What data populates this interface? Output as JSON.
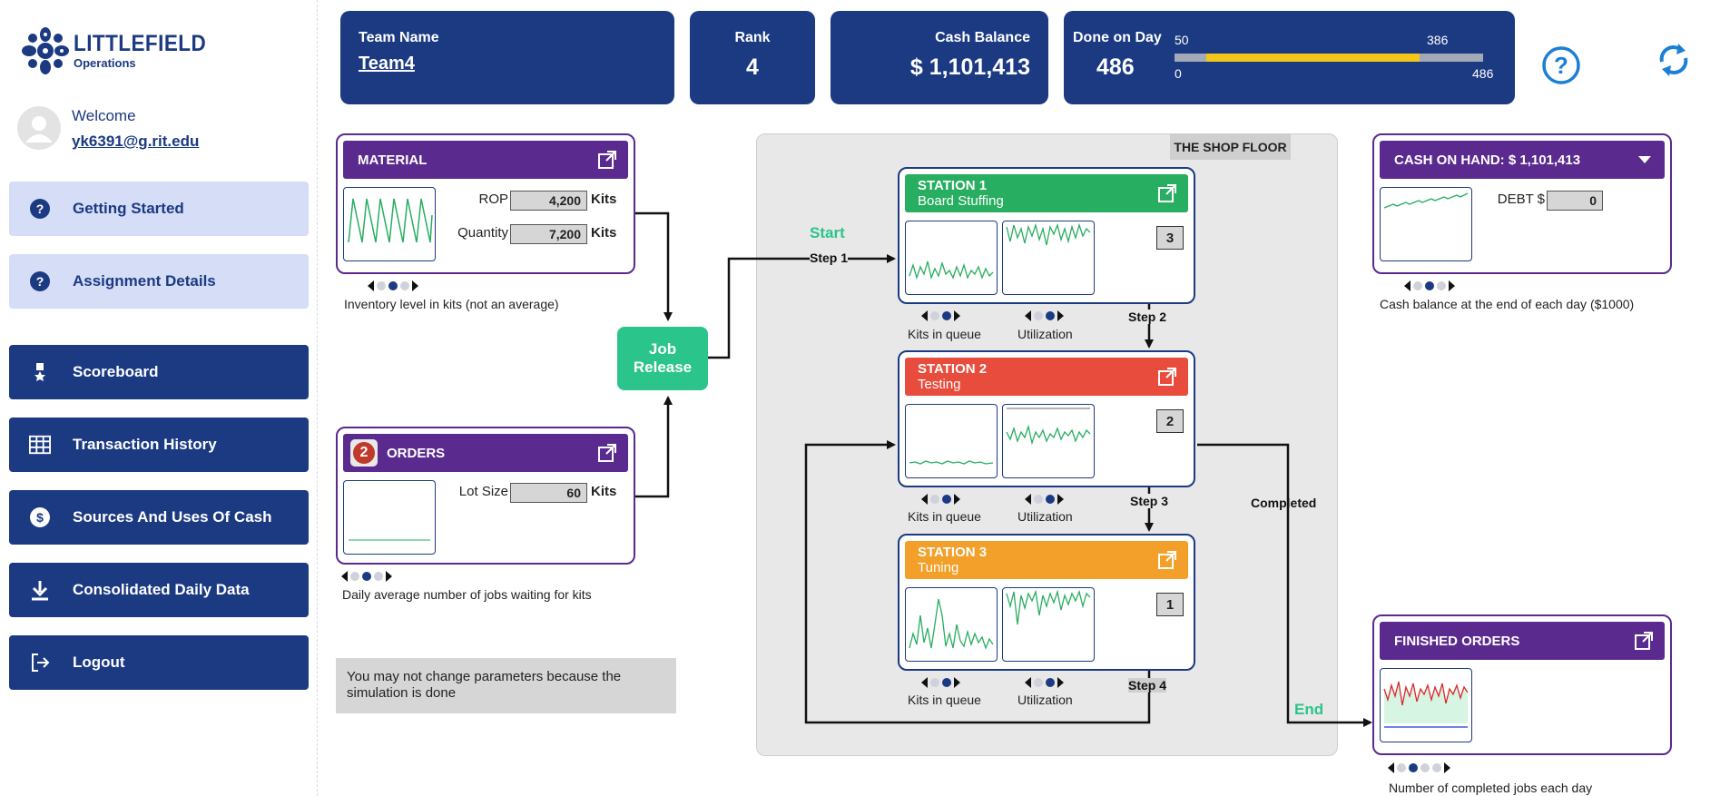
{
  "logo": {
    "line1": "LITTLEFIELD",
    "line2": "Operations"
  },
  "user": {
    "welcome": "Welcome",
    "email": "yk6391@g.rit.edu"
  },
  "sidebar": {
    "items": [
      {
        "label": "Getting Started",
        "icon": "help-circle-icon"
      },
      {
        "label": "Assignment Details",
        "icon": "help-circle-icon"
      },
      {
        "label": "Scoreboard",
        "icon": "medal-icon"
      },
      {
        "label": "Transaction History",
        "icon": "table-icon"
      },
      {
        "label": "Sources And Uses Of Cash",
        "icon": "dollar-icon"
      },
      {
        "label": "Consolidated Daily Data",
        "icon": "download-icon"
      },
      {
        "label": "Logout",
        "icon": "logout-icon"
      }
    ]
  },
  "header": {
    "team_label": "Team Name",
    "team_value": "Team4",
    "rank_label": "Rank",
    "rank_value": "4",
    "cash_label": "Cash Balance",
    "cash_value": "$ 1,101,413",
    "done_label": "Done on Day",
    "done_value": "486",
    "progress": {
      "start_label": "50",
      "current_label": "386",
      "min_label": "0",
      "max_label": "486",
      "start": 50,
      "current": 386,
      "max": 486
    }
  },
  "material": {
    "title": "MATERIAL",
    "rop_label": "ROP",
    "rop_value": "4,200",
    "rop_unit": "Kits",
    "qty_label": "Quantity",
    "qty_value": "7,200",
    "qty_unit": "Kits",
    "caption": "Inventory level in kits (not an average)"
  },
  "orders": {
    "badge": "2",
    "title": "ORDERS",
    "lot_label": "Lot Size",
    "lot_value": "60",
    "lot_unit": "Kits",
    "caption": "Daily average number of jobs waiting for kits"
  },
  "notice": "You may not change parameters because the simulation is done",
  "shop": {
    "title": "THE SHOP FLOOR",
    "job_release": [
      "Job",
      "Release"
    ],
    "start": "Start",
    "end": "End",
    "completed": "Completed",
    "steps": [
      "Step 1",
      "Step 2",
      "Step 3",
      "Step 4"
    ],
    "stations": [
      {
        "title": "STATION 1",
        "name": "Board Stuffing",
        "count": "3",
        "color": "#28ae60"
      },
      {
        "title": "STATION 2",
        "name": "Testing",
        "count": "2",
        "color": "#e74c3c"
      },
      {
        "title": "STATION 3",
        "name": "Tuning",
        "count": "1",
        "color": "#f2a029"
      }
    ],
    "queue_caption": "Kits in queue",
    "util_caption": "Utilization"
  },
  "cash": {
    "title": "CASH ON HAND: $ 1,101,413",
    "debt_label": "DEBT $",
    "debt_value": "0",
    "caption": "Cash balance at the end of each day ($1000)"
  },
  "finished": {
    "title": "FINISHED ORDERS",
    "caption": "Number of completed jobs each day"
  },
  "colors": {
    "navy": "#1b3a82",
    "purple": "#5a2a8f",
    "green": "#2bc48a",
    "light": "#d5ddf7"
  }
}
